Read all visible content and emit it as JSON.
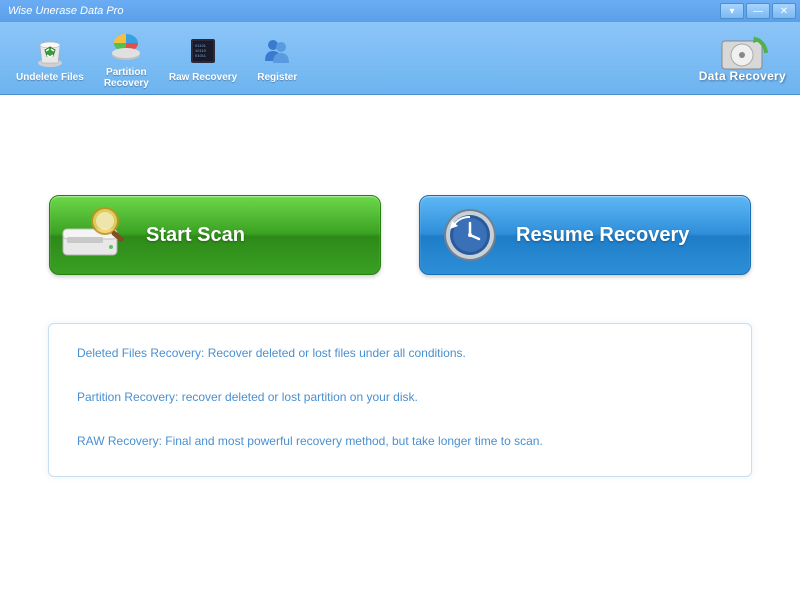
{
  "window": {
    "title": "Wise Unerase Data Pro"
  },
  "toolbar": {
    "undelete": "Undelete Files",
    "partition": "Partition\nRecovery",
    "raw": "Raw Recovery",
    "register": "Register"
  },
  "brand": {
    "label": "Data Recovery"
  },
  "main": {
    "start_scan": "Start  Scan",
    "resume_recovery": "Resume Recovery"
  },
  "info": {
    "line1": "Deleted Files Recovery: Recover deleted or lost files  under all conditions.",
    "line2": "Partition Recovery: recover deleted or lost partition on your disk.",
    "line3": "RAW Recovery: Final and most powerful recovery method, but take longer time to scan."
  }
}
